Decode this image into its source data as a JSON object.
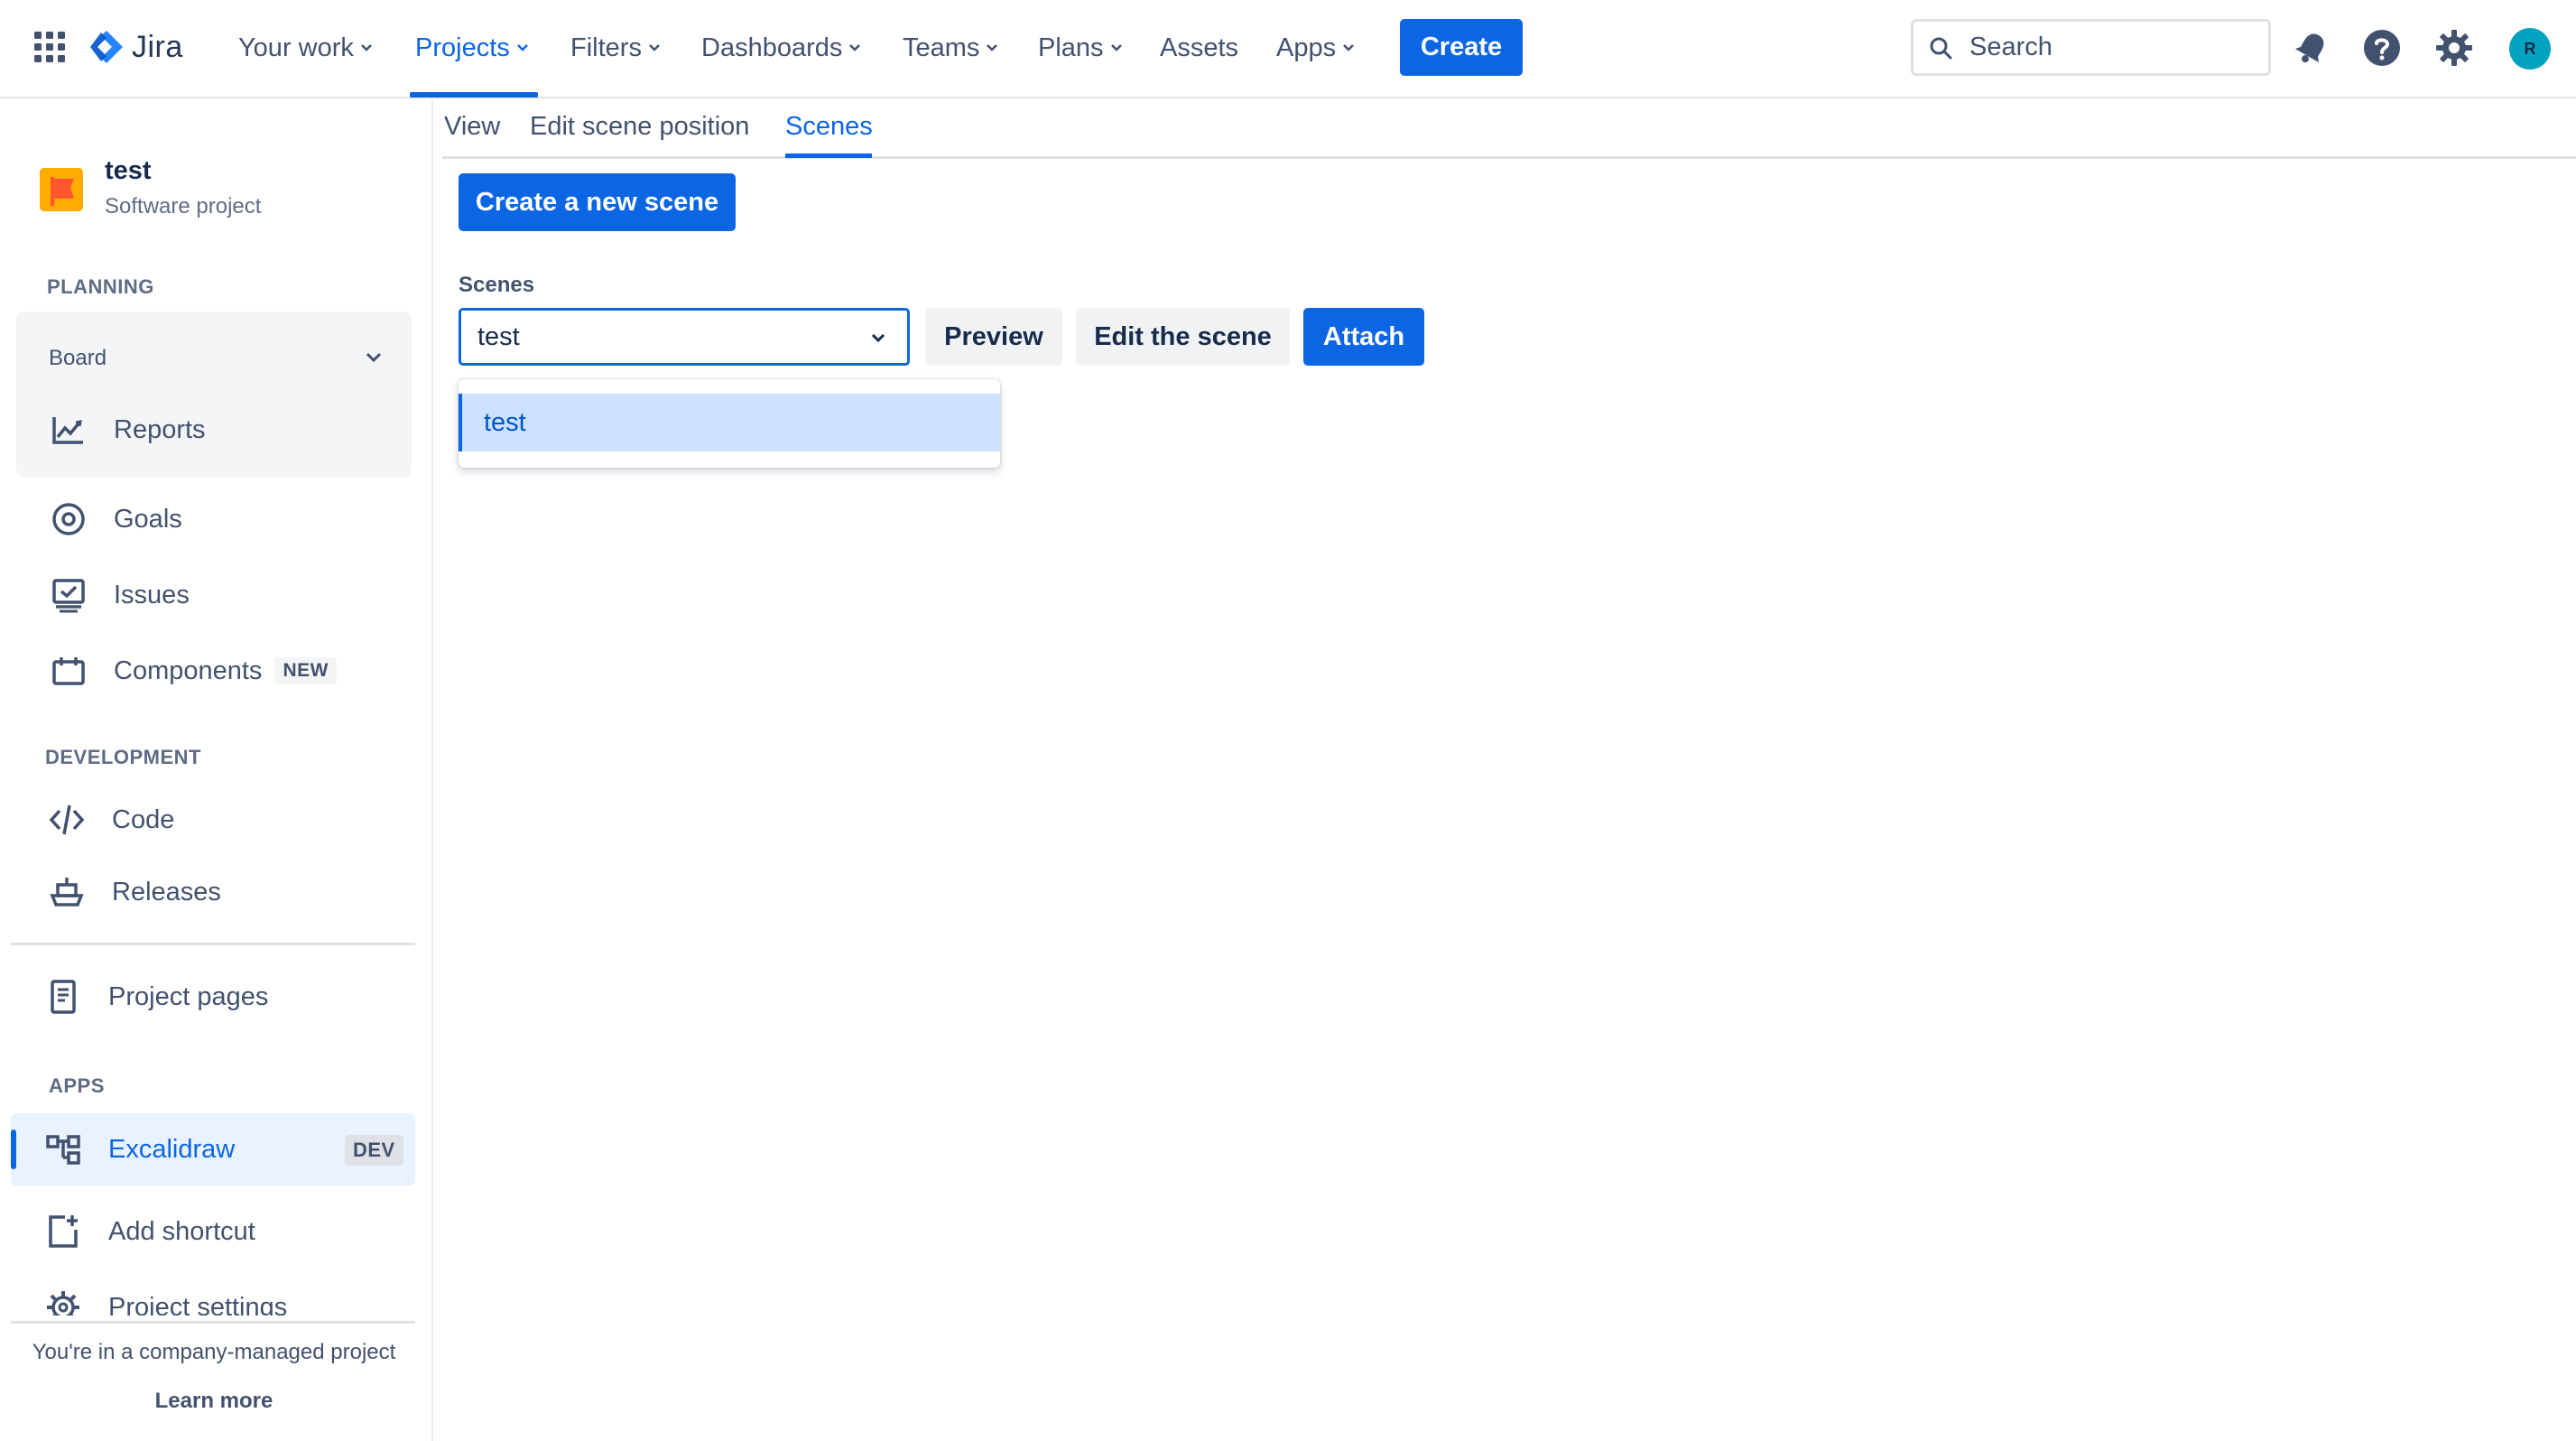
{
  "topnav": {
    "logo_text": "Jira",
    "items": [
      {
        "label": "Your work",
        "dropdown": true
      },
      {
        "label": "Projects",
        "dropdown": true,
        "active": true
      },
      {
        "label": "Filters",
        "dropdown": true
      },
      {
        "label": "Dashboards",
        "dropdown": true
      },
      {
        "label": "Teams",
        "dropdown": true
      },
      {
        "label": "Plans",
        "dropdown": true
      },
      {
        "label": "Assets",
        "dropdown": false
      },
      {
        "label": "Apps",
        "dropdown": true
      }
    ],
    "create_label": "Create",
    "search_placeholder": "Search",
    "avatar_initial": "R",
    "colors": {
      "accent": "#0c66e4",
      "avatar": "#00a3bf"
    }
  },
  "sidebar": {
    "project": {
      "name": "test",
      "type": "Software project"
    },
    "planning_title": "PLANNING",
    "board_label": "Board",
    "reports_label": "Reports",
    "goals_label": "Goals",
    "issues_label": "Issues",
    "components_label": "Components",
    "components_badge": "NEW",
    "development_title": "DEVELOPMENT",
    "code_label": "Code",
    "releases_label": "Releases",
    "project_pages_label": "Project pages",
    "apps_title": "APPS",
    "excalidraw_label": "Excalidraw",
    "excalidraw_badge": "DEV",
    "add_shortcut_label": "Add shortcut",
    "project_settings_label": "Project settings",
    "footer_text": "You're in a company-managed project",
    "footer_link": "Learn more"
  },
  "main": {
    "tabs": [
      {
        "label": "View"
      },
      {
        "label": "Edit scene position"
      },
      {
        "label": "Scenes",
        "active": true
      }
    ],
    "create_scene_label": "Create a new scene",
    "scenes_label": "Scenes",
    "selected_scene": "test",
    "preview_label": "Preview",
    "edit_scene_label": "Edit the scene",
    "attach_label": "Attach",
    "dropdown_options": [
      "test"
    ]
  }
}
